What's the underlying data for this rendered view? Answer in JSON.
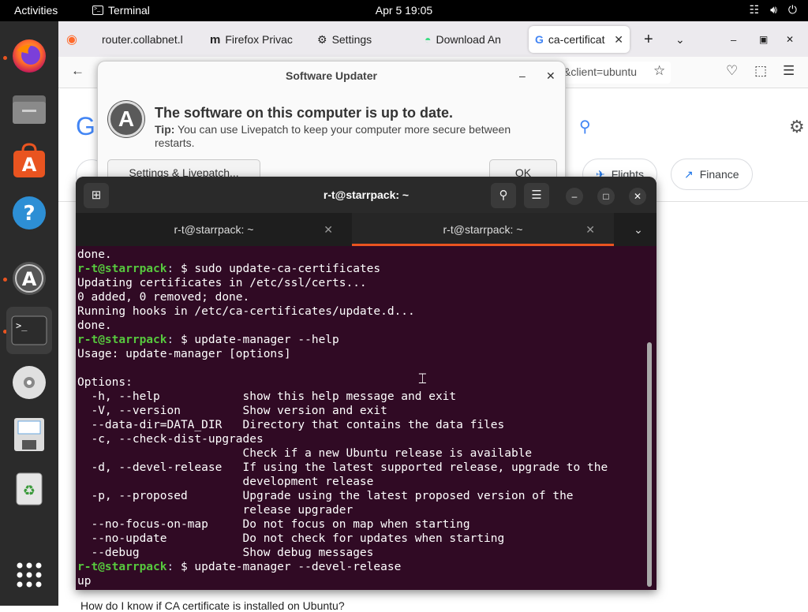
{
  "topbar": {
    "activities": "Activities",
    "app_name": "Terminal",
    "clock": "Apr 5  19:05"
  },
  "browser": {
    "tabs": [
      "router.collabnet.l",
      "Firefox Privac",
      "Settings",
      "Download An",
      "ca-certificat"
    ],
    "url_fragment": "&client=ubuntu",
    "chips": [
      "Flights",
      "Finance"
    ]
  },
  "updater": {
    "title": "Software Updater",
    "message": "The software on this computer is up to date.",
    "tip_label": "Tip:",
    "tip_text": " You can use Livepatch to keep your computer more secure between restarts.",
    "settings_button": "Settings & Livepatch...",
    "ok_button": "OK"
  },
  "terminal": {
    "title": "r-t@starrpack: ~",
    "tabs": [
      "r-t@starrpack: ~",
      "r-t@starrpack: ~"
    ],
    "prompt": "r-t@starrpack",
    "lines": [
      {
        "t": "out",
        "text": "done."
      },
      {
        "t": "cmd",
        "text": "sudo update-ca-certificates"
      },
      {
        "t": "out",
        "text": "Updating certificates in /etc/ssl/certs..."
      },
      {
        "t": "out",
        "text": "0 added, 0 removed; done."
      },
      {
        "t": "out",
        "text": "Running hooks in /etc/ca-certificates/update.d..."
      },
      {
        "t": "out",
        "text": "done."
      },
      {
        "t": "cmd",
        "text": "update-manager --help"
      },
      {
        "t": "out",
        "text": "Usage: update-manager [options]"
      },
      {
        "t": "out",
        "text": ""
      },
      {
        "t": "out",
        "text": "Options:"
      },
      {
        "t": "out",
        "text": "  -h, --help            show this help message and exit"
      },
      {
        "t": "out",
        "text": "  -V, --version         Show version and exit"
      },
      {
        "t": "out",
        "text": "  --data-dir=DATA_DIR   Directory that contains the data files"
      },
      {
        "t": "out",
        "text": "  -c, --check-dist-upgrades"
      },
      {
        "t": "out",
        "text": "                        Check if a new Ubuntu release is available"
      },
      {
        "t": "out",
        "text": "  -d, --devel-release   If using the latest supported release, upgrade to the"
      },
      {
        "t": "out",
        "text": "                        development release"
      },
      {
        "t": "out",
        "text": "  -p, --proposed        Upgrade using the latest proposed version of the"
      },
      {
        "t": "out",
        "text": "                        release upgrader"
      },
      {
        "t": "out",
        "text": "  --no-focus-on-map     Do not focus on map when starting"
      },
      {
        "t": "out",
        "text": "  --no-update           Do not check for updates when starting"
      },
      {
        "t": "out",
        "text": "  --debug               Show debug messages"
      },
      {
        "t": "cmd",
        "text": "update-manager --devel-release"
      },
      {
        "t": "out",
        "text": "up"
      }
    ]
  },
  "page_footer_text": "How do I know if CA certificate is installed on Ubuntu?"
}
